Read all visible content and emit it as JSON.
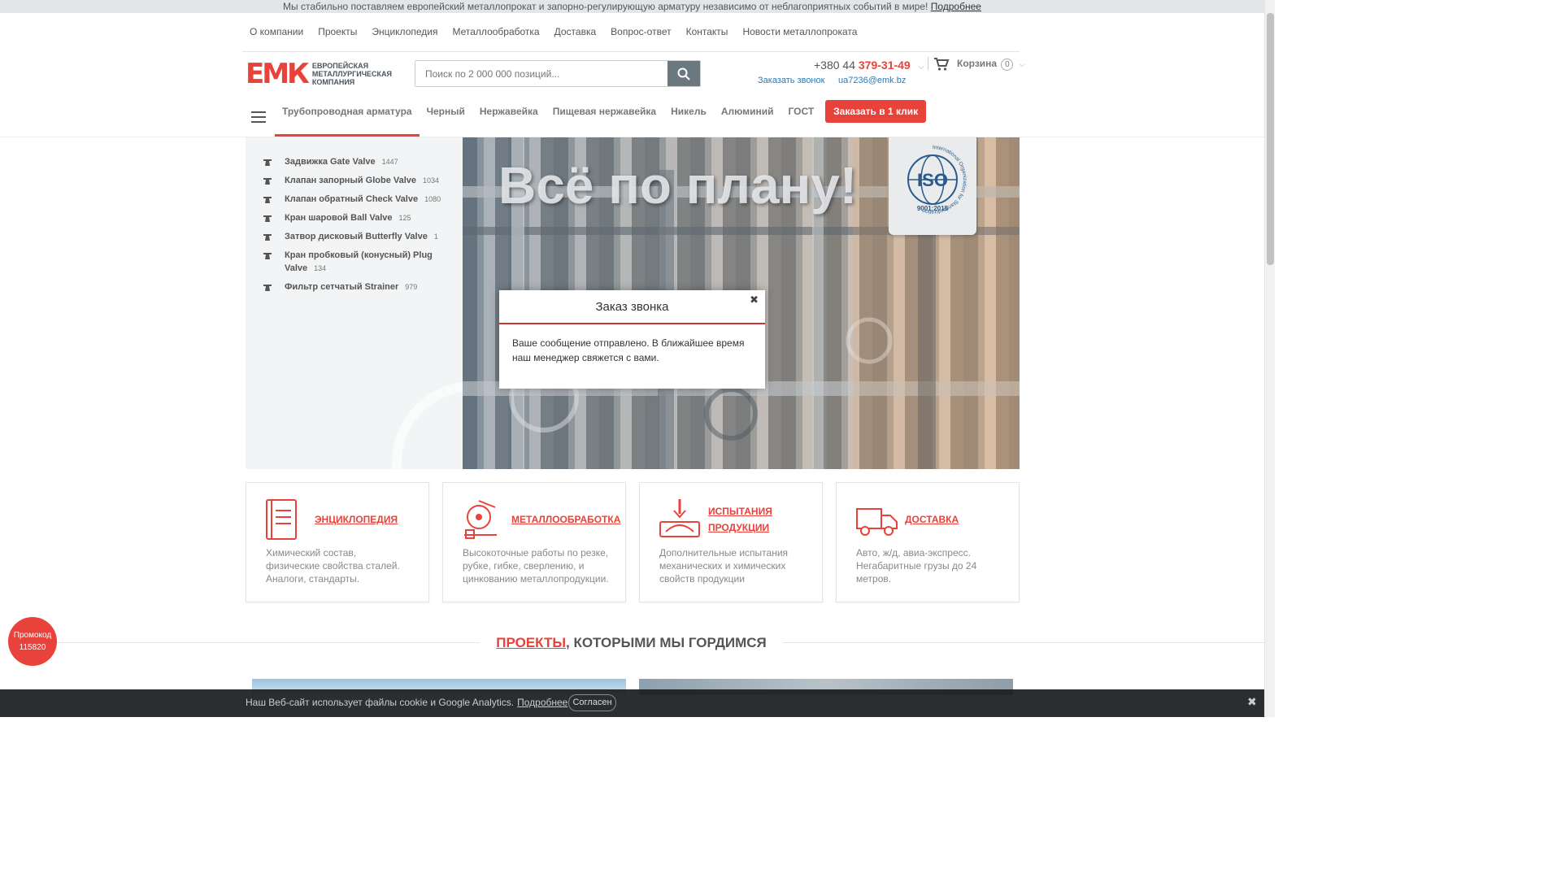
{
  "announcement": {
    "text": "Мы стабильно поставляем европейский металлопрокат и запорно-регулирующую арматуру независимо от неблагоприятных событий в мире!",
    "link": "Подробнее"
  },
  "top_nav": [
    "О компании",
    "Проекты",
    "Энциклопедия",
    "Металлообработка",
    "Доставка",
    "Вопрос-ответ",
    "Контакты",
    "Новости металлопроката"
  ],
  "logo": {
    "mark": "ЕМК",
    "line1": "ЕВРОПЕЙСКАЯ",
    "line2": "МЕТАЛЛУРГИЧЕСКАЯ",
    "line3": "КОМПАНИЯ"
  },
  "search": {
    "placeholder": "Поиск по 2 000 000 позиций..."
  },
  "contact": {
    "phone_prefix": "+380 44",
    "phone_main": "379-31-49",
    "callback": "Заказать звонок",
    "email": "ua7236@emk.bz"
  },
  "cart": {
    "label": "Корзина",
    "count": "0"
  },
  "catalog_nav": {
    "items": [
      "Трубопроводная арматура",
      "Черный",
      "Нержавейка",
      "Пищевая нержавейка",
      "Никель",
      "Алюминий",
      "ГОСТ"
    ],
    "order_button": "Заказать в 1 клик"
  },
  "sidebar": {
    "items": [
      {
        "label": "Задвижка Gate Valve",
        "count": "1447"
      },
      {
        "label": "Клапан запорный Globe Valve",
        "count": "1034"
      },
      {
        "label": "Клапан обратный Check Valve",
        "count": "1080"
      },
      {
        "label": "Кран шаровой Ball Valve",
        "count": "125"
      },
      {
        "label": "Затвор дисковый Butterfly Valve",
        "count": "1"
      },
      {
        "label": "Кран пробковый (конусный) Plug Valve",
        "count": "134"
      },
      {
        "label": "Фильтр сетчатый Strainer",
        "count": "979"
      }
    ]
  },
  "hero": {
    "headline": "Всё по плану!",
    "iso_badge": "ISO",
    "iso_version": "9001:2015",
    "iso_ring_text": "International Organization for Standardization"
  },
  "modal": {
    "title": "Заказ звонка",
    "close": "✖",
    "message": "Ваше сообщение отправлено. В ближайшее время наш менеджер свяжется с вами."
  },
  "features": [
    {
      "title": "ЭНЦИКЛОПЕДИЯ",
      "desc": "Химический состав, физические свойства сталей. Аналоги, стандарты.",
      "icon": "book-icon"
    },
    {
      "title": "МЕТАЛЛООБРАБОТКА",
      "desc": "Высокоточные работы по резке, рубке, гибке, сверлению, и цинкованию металлопродукции.",
      "icon": "saw-icon"
    },
    {
      "title": "ИСПЫТАНИЯ ПРОДУКЦИИ",
      "desc": "Дополнительные испытания механических и химических свойств продукции",
      "icon": "testing-icon"
    },
    {
      "title": "ДОСТАВКА",
      "desc": "Авто, ж/д, авиа-экспресс. Негабаритные грузы до 24 метров.",
      "icon": "truck-icon"
    }
  ],
  "promo": {
    "label": "Промокод",
    "code": "115820"
  },
  "projects": {
    "link": "ПРОЕКТЫ",
    "rest": ", КОТОРЫМИ МЫ ГОРДИМСЯ"
  },
  "cookie": {
    "text": "Наш Веб-сайт использует файлы cookie и Google Analytics.",
    "link": "Подробнее",
    "accept": "Согласен",
    "close": "✖"
  },
  "colors": {
    "accent": "#e8423a",
    "link": "#2a7ab7",
    "dark": "#4a5560"
  }
}
